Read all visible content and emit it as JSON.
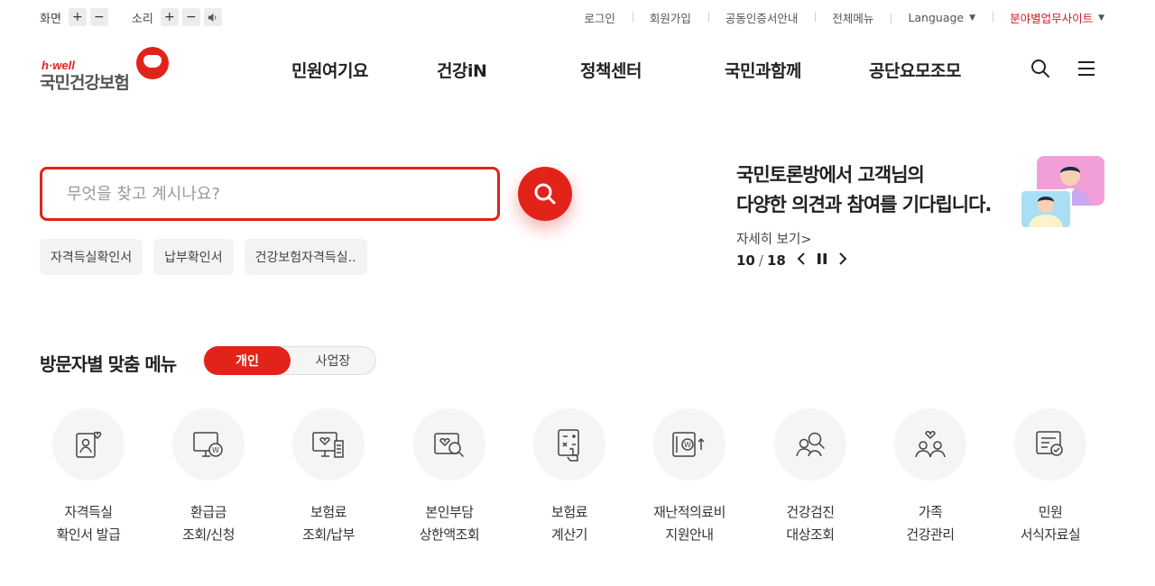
{
  "util": {
    "screen_label": "화면",
    "sound_label": "소리",
    "plus": "+",
    "minus": "−",
    "links": [
      "로그인",
      "회원가입",
      "공동인증서안내",
      "전체메뉴"
    ],
    "language": "Language",
    "sites": "분야별업무사이트"
  },
  "logo": {
    "tag": "h·well",
    "name": "국민건강보험"
  },
  "gnb": [
    "민원여기요",
    "건강iN",
    "정책센터",
    "국민과함께",
    "공단요모조모"
  ],
  "search": {
    "placeholder": "무엇을 찾고 계시나요?",
    "chips": [
      "자격득실확인서",
      "납부확인서",
      "건강보험자격득실.."
    ]
  },
  "promo": {
    "line1": "국민토론방에서 고객님의",
    "line2": "다양한 의견과 참여를 기다립니다.",
    "more": "자세히 보기",
    "current": "10",
    "total": "18"
  },
  "menu_section": {
    "title": "방문자별 맞춤 메뉴",
    "tab_personal": "개인",
    "tab_business": "사업장",
    "items": [
      {
        "icon": "certificate-icon",
        "line1": "자격득실",
        "line2": "확인서 발급"
      },
      {
        "icon": "refund-monitor-icon",
        "line1": "환급금",
        "line2": "조회/신청"
      },
      {
        "icon": "premium-payment-icon",
        "line1": "보험료",
        "line2": "조회/납부"
      },
      {
        "icon": "copay-search-icon",
        "line1": "본인부담",
        "line2": "상한액조회"
      },
      {
        "icon": "calculator-icon",
        "line1": "보험료",
        "line2": "계산기"
      },
      {
        "icon": "medical-support-icon",
        "line1": "재난적의료비",
        "line2": "지원안내"
      },
      {
        "icon": "checkup-search-icon",
        "line1": "건강검진",
        "line2": "대상조회"
      },
      {
        "icon": "family-icon",
        "line1": "가족",
        "line2": "건강관리"
      },
      {
        "icon": "forms-library-icon",
        "line1": "민원",
        "line2": "서식자료실"
      }
    ]
  },
  "colors": {
    "accent": "#e2231a",
    "text": "#222222",
    "chip_bg": "#f3f3f3",
    "icon_bg": "#f5f5f5"
  }
}
